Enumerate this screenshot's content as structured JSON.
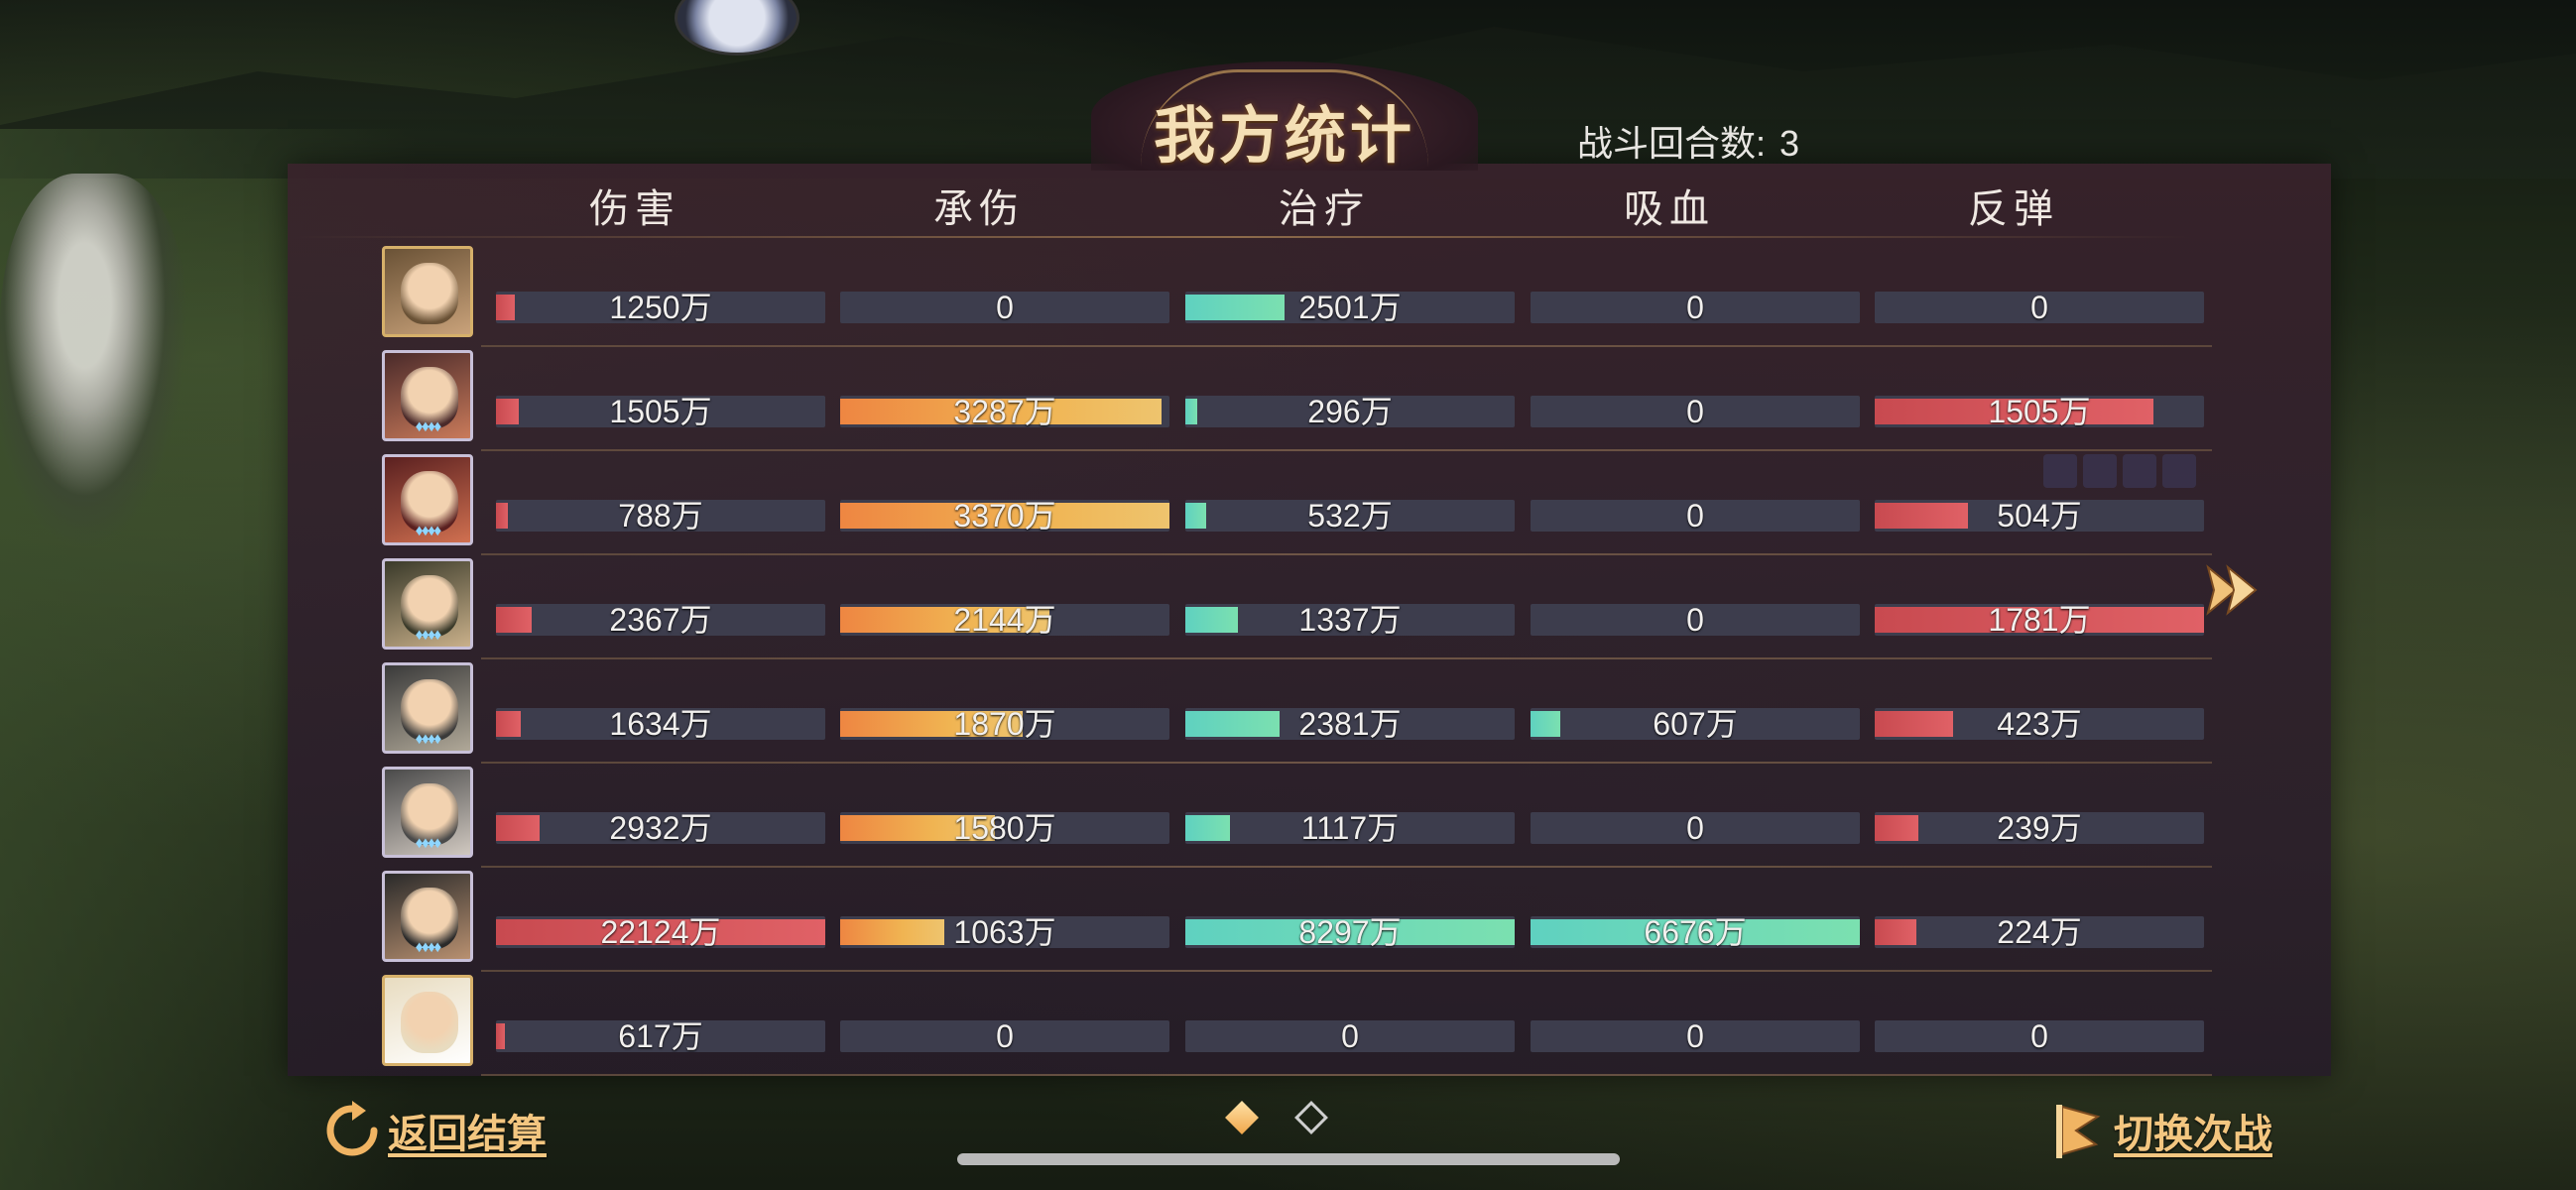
{
  "title": "我方统计",
  "rounds": {
    "label": "战斗回合数:",
    "value": "3"
  },
  "columns": [
    "伤害",
    "承伤",
    "治疗",
    "吸血",
    "反弹"
  ],
  "rows": [
    {
      "avatar": "hero-1-icon",
      "cells": [
        {
          "text": "1250万",
          "fill": 0.056,
          "color": "red"
        },
        {
          "text": "0",
          "fill": 0,
          "color": "orange"
        },
        {
          "text": "2501万",
          "fill": 0.301,
          "color": "teal"
        },
        {
          "text": "0",
          "fill": 0,
          "color": "teal"
        },
        {
          "text": "0",
          "fill": 0,
          "color": "red"
        }
      ]
    },
    {
      "avatar": "hero-2-icon",
      "cells": [
        {
          "text": "1505万",
          "fill": 0.068,
          "color": "red"
        },
        {
          "text": "3287万",
          "fill": 0.975,
          "color": "orange"
        },
        {
          "text": "296万",
          "fill": 0.036,
          "color": "teal"
        },
        {
          "text": "0",
          "fill": 0,
          "color": "teal"
        },
        {
          "text": "1505万",
          "fill": 0.845,
          "color": "red"
        }
      ]
    },
    {
      "avatar": "hero-3-icon",
      "cells": [
        {
          "text": "788万",
          "fill": 0.036,
          "color": "red"
        },
        {
          "text": "3370万",
          "fill": 1.0,
          "color": "orange"
        },
        {
          "text": "532万",
          "fill": 0.064,
          "color": "teal"
        },
        {
          "text": "0",
          "fill": 0,
          "color": "teal"
        },
        {
          "text": "504万",
          "fill": 0.283,
          "color": "red"
        }
      ]
    },
    {
      "avatar": "hero-4-icon",
      "cells": [
        {
          "text": "2367万",
          "fill": 0.107,
          "color": "red"
        },
        {
          "text": "2144万",
          "fill": 0.636,
          "color": "orange"
        },
        {
          "text": "1337万",
          "fill": 0.161,
          "color": "teal"
        },
        {
          "text": "0",
          "fill": 0,
          "color": "teal"
        },
        {
          "text": "1781万",
          "fill": 1.0,
          "color": "red"
        }
      ]
    },
    {
      "avatar": "hero-5-icon",
      "cells": [
        {
          "text": "1634万",
          "fill": 0.074,
          "color": "red"
        },
        {
          "text": "1870万",
          "fill": 0.555,
          "color": "orange"
        },
        {
          "text": "2381万",
          "fill": 0.287,
          "color": "teal"
        },
        {
          "text": "607万",
          "fill": 0.091,
          "color": "teal"
        },
        {
          "text": "423万",
          "fill": 0.238,
          "color": "red"
        }
      ]
    },
    {
      "avatar": "hero-6-icon",
      "cells": [
        {
          "text": "2932万",
          "fill": 0.133,
          "color": "red"
        },
        {
          "text": "1580万",
          "fill": 0.469,
          "color": "orange"
        },
        {
          "text": "1117万",
          "fill": 0.135,
          "color": "teal"
        },
        {
          "text": "0",
          "fill": 0,
          "color": "teal"
        },
        {
          "text": "239万",
          "fill": 0.134,
          "color": "red"
        }
      ]
    },
    {
      "avatar": "hero-7-icon",
      "cells": [
        {
          "text": "22124万",
          "fill": 1.0,
          "color": "red"
        },
        {
          "text": "1063万",
          "fill": 0.315,
          "color": "orange"
        },
        {
          "text": "8297万",
          "fill": 1.0,
          "color": "teal"
        },
        {
          "text": "6676万",
          "fill": 1.0,
          "color": "teal"
        },
        {
          "text": "224万",
          "fill": 0.126,
          "color": "red"
        }
      ]
    },
    {
      "avatar": "white-deer-icon",
      "cells": [
        {
          "text": "617万",
          "fill": 0.028,
          "color": "red"
        },
        {
          "text": "0",
          "fill": 0,
          "color": "orange"
        },
        {
          "text": "0",
          "fill": 0,
          "color": "teal"
        },
        {
          "text": "0",
          "fill": 0,
          "color": "teal"
        },
        {
          "text": "0",
          "fill": 0,
          "color": "red"
        }
      ]
    }
  ],
  "bottom": {
    "back_label": "返回结算",
    "switch_label": "切换次战"
  },
  "pager": {
    "pages": 2,
    "active": 0
  }
}
